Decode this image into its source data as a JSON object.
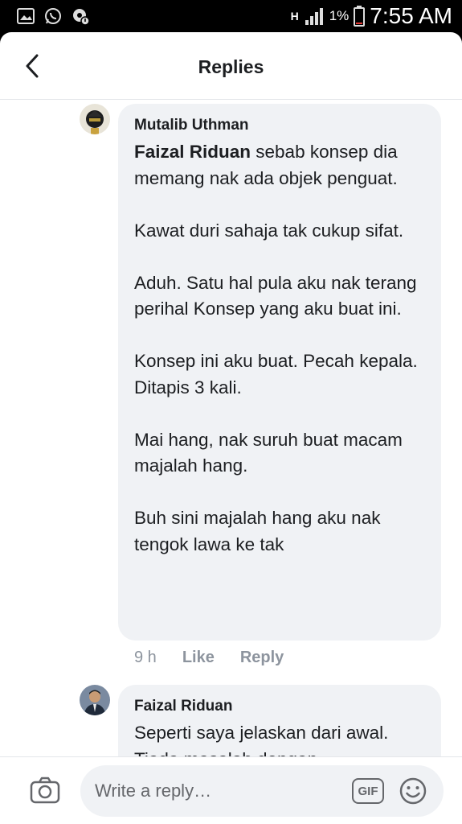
{
  "status_bar": {
    "network": "H",
    "battery": "1%",
    "time": "7:55 AM",
    "icons": [
      "gallery-icon",
      "whatsapp-icon",
      "settings-alert-icon",
      "signal-icon",
      "battery-icon"
    ]
  },
  "header": {
    "title": "Replies",
    "back_icon": "chevron-left-icon"
  },
  "comments": [
    {
      "author": "Mutalib Uthman",
      "mention": "Faizal Riduan",
      "paragraphs": [
        " sebab konsep dia memang nak ada objek penguat.",
        "Kawat duri sahaja tak cukup sifat.",
        "Aduh. Satu hal pula aku nak terang perihal Konsep yang aku buat ini.",
        "Konsep ini aku buat. Pecah kepala. Ditapis 3 kali.",
        "Mai hang, nak suruh buat macam majalah hang.",
        "Buh sini majalah hang aku nak tengok lawa ke tak"
      ],
      "time": "9 h",
      "like_label": "Like",
      "reply_label": "Reply"
    },
    {
      "author": "Faizal Riduan",
      "paragraphs": [
        "Seperti saya jelaskan dari awal.",
        "Tiada masalah dengan"
      ]
    }
  ],
  "composer": {
    "placeholder": "Write a reply…",
    "gif_label": "GIF",
    "camera_icon": "camera-icon",
    "emoji_icon": "emoji-icon"
  },
  "colors": {
    "bubble_bg": "#f0f2f5",
    "text": "#1c1e21",
    "meta": "#8d949e"
  }
}
